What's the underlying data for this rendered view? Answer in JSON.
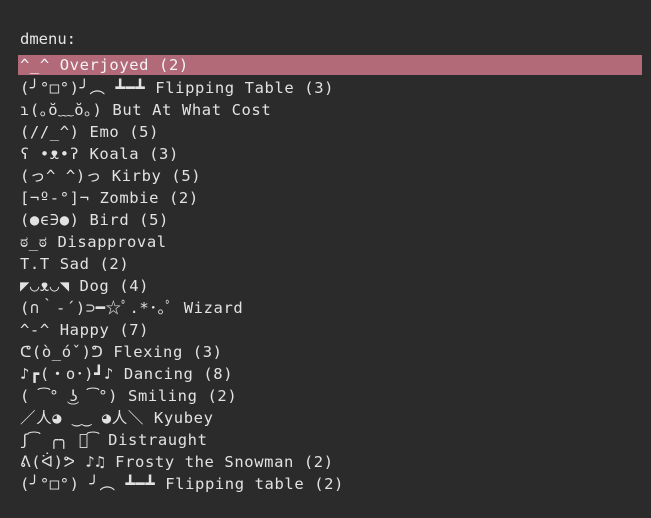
{
  "prompt": "dmenu:",
  "colors": {
    "background": "#2b2b2b",
    "foreground": "#e2e2e2",
    "selected_background": "#b36a78"
  },
  "items": [
    {
      "label": "^_^ Overjoyed (2)",
      "selected": true
    },
    {
      "label": "(╯°□°)╯︵ ┻━┻ Flipping Table (3)",
      "selected": false
    },
    {
      "label": "ɿ(｡ŏ﹏ŏ｡) But At What Cost",
      "selected": false
    },
    {
      "label": "(//_^) Emo (5)",
      "selected": false
    },
    {
      "label": "ʕ •ᴥ•ʔ Koala (3)",
      "selected": false
    },
    {
      "label": "(っ^ ^)っ Kirby (5)",
      "selected": false
    },
    {
      "label": "[¬º-°]¬ Zombie (2)",
      "selected": false
    },
    {
      "label": "(●ϵ∋●) Bird (5)",
      "selected": false
    },
    {
      "label": "ಠ_ಠ Disapproval",
      "selected": false
    },
    {
      "label": "T.T Sad (2)",
      "selected": false
    },
    {
      "label": "◤◡ᴥ◡◥ Dog (4)",
      "selected": false
    },
    {
      "label": "(∩｀-´)⊃━☆ﾟ.*･｡ﾟ Wizard",
      "selected": false
    },
    {
      "label": "^-^ Happy (7)",
      "selected": false
    },
    {
      "label": "ᕦ(ò_óˇ)ᕤ Flexing (3)",
      "selected": false
    },
    {
      "label": "♪┏(・o･)┛♪ Dancing (8)",
      "selected": false
    },
    {
      "label": "( ͡° ͜ʖ ͡°) Smiling (2)",
      "selected": false
    },
    {
      "label": "／人◕ ‿‿ ◕人＼ Kyubey",
      "selected": false
    },
    {
      "label": "ʃ͡ ╭╮ ﾉ͡ Distraught",
      "selected": false
    },
    {
      "label": "ᕕ(ᐛ)ᕗ ♪♫ Frosty the Snowman (2)",
      "selected": false
    },
    {
      "label": "(╯°□°) ╯︵ ┻━┻ Flipping table (2)",
      "selected": false
    }
  ]
}
